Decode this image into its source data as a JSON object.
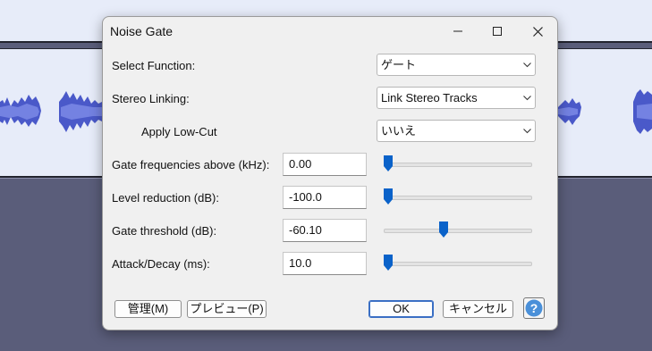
{
  "dialog": {
    "title": "Noise Gate",
    "controls": {
      "minimize": "minimize",
      "maximize": "maximize",
      "close": "close"
    }
  },
  "fields": {
    "select_function": {
      "label": "Select Function:",
      "value": "ゲート"
    },
    "stereo_linking": {
      "label": "Stereo Linking:",
      "value": "Link Stereo Tracks"
    },
    "apply_low_cut": {
      "label": "Apply Low-Cut",
      "value": "いいえ"
    },
    "gate_frequencies": {
      "label": "Gate frequencies above (kHz):",
      "value": "0.00",
      "slider_fraction": 0.0
    },
    "level_reduction": {
      "label": "Level reduction (dB):",
      "value": "-100.0",
      "slider_fraction": 0.0
    },
    "gate_threshold": {
      "label": "Gate threshold (dB):",
      "value": "-60.10",
      "slider_fraction": 0.4
    },
    "attack_decay": {
      "label": "Attack/Decay (ms):",
      "value": "10.0",
      "slider_fraction": 0.0
    }
  },
  "buttons": {
    "manage": "管理(M)",
    "preview": "プレビュー(P)",
    "ok": "OK",
    "cancel": "キャンセル",
    "help": "?"
  },
  "colors": {
    "waveform": "#4a59c9",
    "waveform_core": "#7482e2",
    "slider_thumb": "#0a62c9",
    "help_icon": "#4a90d9"
  }
}
